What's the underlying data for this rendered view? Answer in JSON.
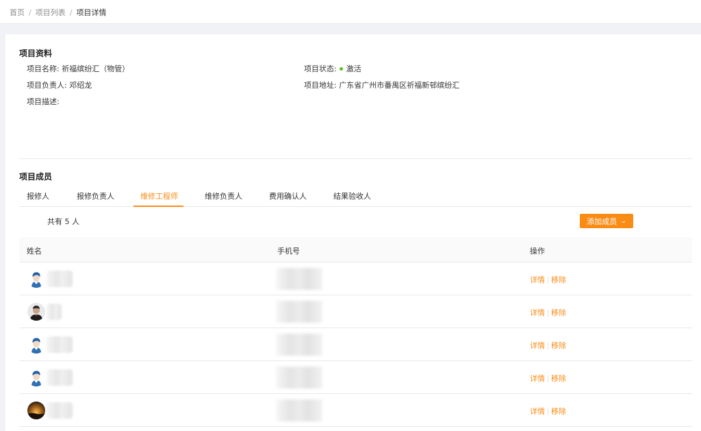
{
  "breadcrumb": {
    "home": "首页",
    "list": "项目列表",
    "current": "项目详情",
    "separator": "/"
  },
  "info": {
    "title": "项目资料",
    "name_label": "项目名称:",
    "name_value": "祈福缤纷汇（物管）",
    "status_label": "项目状态:",
    "status_value": "激活",
    "owner_label": "项目负责人:",
    "owner_value": "邓绍龙",
    "address_label": "项目地址:",
    "address_value": "广东省广州市番禺区祈福新邨缤纷汇",
    "desc_label": "项目描述:",
    "desc_value": ""
  },
  "members": {
    "title": "项目成员",
    "tabs": [
      "报修人",
      "报修负责人",
      "维修工程师",
      "维修负责人",
      "费用确认人",
      "结果验收人"
    ],
    "active_tab": 2,
    "count_text": "共有 5 人",
    "add_button": "添加成员",
    "columns": {
      "name": "姓名",
      "phone": "手机号",
      "actions": "操作"
    },
    "rows": [
      {
        "avatar": "avatar-illustration-blue",
        "detail": "详情",
        "remove": "移除"
      },
      {
        "avatar": "avatar-photo-person",
        "detail": "详情",
        "remove": "移除"
      },
      {
        "avatar": "avatar-illustration-blue",
        "detail": "详情",
        "remove": "移除"
      },
      {
        "avatar": "avatar-illustration-blue",
        "detail": "详情",
        "remove": "移除"
      },
      {
        "avatar": "avatar-photo-sunset",
        "detail": "详情",
        "remove": "移除"
      }
    ]
  },
  "colors": {
    "accent": "#fa8c16",
    "status": "#52c41a"
  }
}
